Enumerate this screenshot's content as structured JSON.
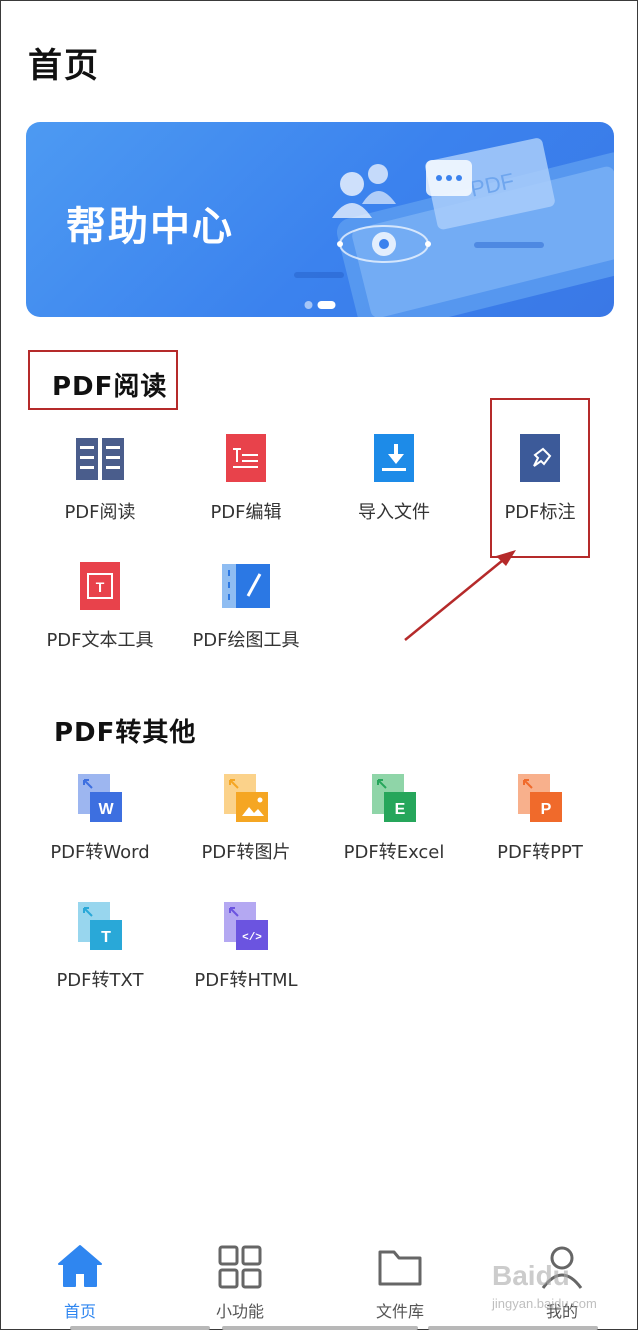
{
  "header": {
    "title": "首页"
  },
  "banner": {
    "text": "帮助中心",
    "art_label": "PDF"
  },
  "sections": [
    {
      "title": "PDF阅读",
      "items": [
        {
          "label": "PDF阅读",
          "icon": "book-icon",
          "color": "#4a5d8c"
        },
        {
          "label": "PDF编辑",
          "icon": "edit-doc-icon",
          "color": "#e8424b"
        },
        {
          "label": "导入文件",
          "icon": "import-icon",
          "color": "#1d8be8"
        },
        {
          "label": "PDF标注",
          "icon": "pin-icon",
          "color": "#3c5a99"
        },
        {
          "label": "PDF文本工具",
          "icon": "text-tool-icon",
          "color": "#e8424b"
        },
        {
          "label": "PDF绘图工具",
          "icon": "draw-tool-icon",
          "color": "#2b78e4"
        }
      ]
    },
    {
      "title": "PDF转其他",
      "items": [
        {
          "label": "PDF转Word",
          "icon": "word-icon",
          "letter": "W",
          "color": "#3d6fe0"
        },
        {
          "label": "PDF转图片",
          "icon": "image-icon",
          "letter": "",
          "color": "#f5a623"
        },
        {
          "label": "PDF转Excel",
          "icon": "excel-icon",
          "letter": "E",
          "color": "#26a65b"
        },
        {
          "label": "PDF转PPT",
          "icon": "ppt-icon",
          "letter": "P",
          "color": "#f06a2b"
        },
        {
          "label": "PDF转TXT",
          "icon": "txt-icon",
          "letter": "T",
          "color": "#29a8d8"
        },
        {
          "label": "PDF转HTML",
          "icon": "html-icon",
          "letter": "</>",
          "color": "#6b54e0"
        }
      ]
    }
  ],
  "nav": [
    {
      "label": "首页",
      "icon": "home-icon",
      "active": true
    },
    {
      "label": "小功能",
      "icon": "grid-icon",
      "active": false
    },
    {
      "label": "文件库",
      "icon": "folder-icon",
      "active": false
    },
    {
      "label": "我的",
      "icon": "user-icon",
      "active": false
    }
  ],
  "watermark": {
    "brand": "Baidu",
    "sub": "jingyan.baidu.com"
  },
  "colors": {
    "accent": "#2f86f0",
    "highlight": "#b52a2a"
  }
}
